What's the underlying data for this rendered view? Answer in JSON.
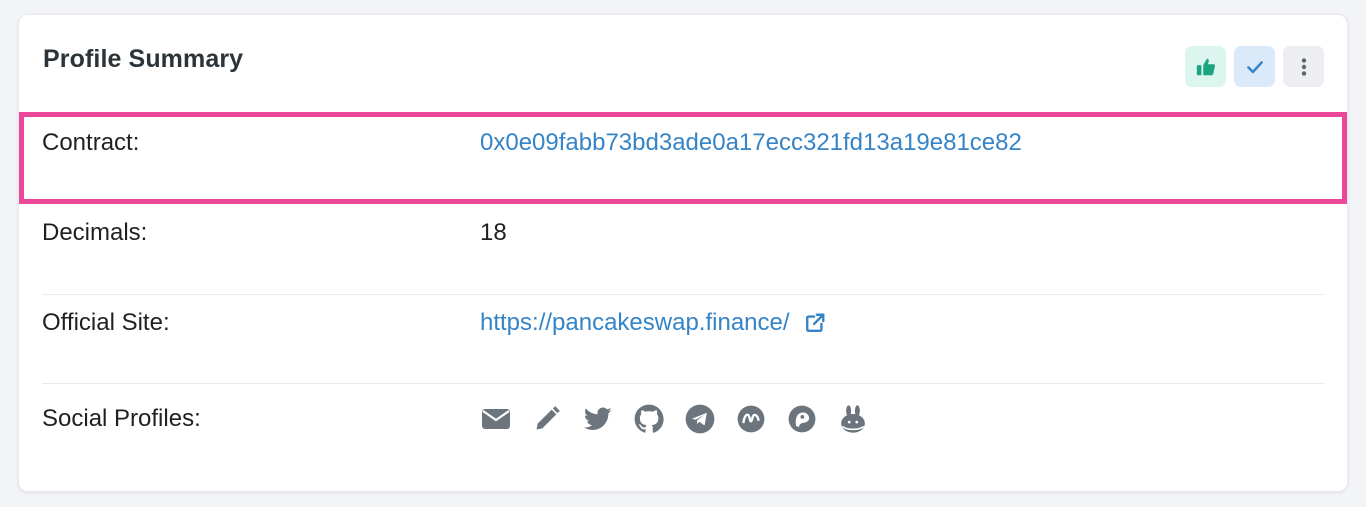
{
  "card": {
    "title": "Profile Summary",
    "actions": [
      {
        "name": "like",
        "icon": "thumbs-up-icon",
        "color": "#1aa47f"
      },
      {
        "name": "check",
        "icon": "check-icon",
        "color": "#3584c7"
      },
      {
        "name": "more",
        "icon": "vertical-ellipsis-icon",
        "color": "#6c757d"
      }
    ]
  },
  "rows": {
    "contract": {
      "label": "Contract:",
      "value": "0x0e09fabb73bd3ade0a17ecc321fd13a19e81ce82"
    },
    "decimals": {
      "label": "Decimals:",
      "value": "18"
    },
    "official_site": {
      "label": "Official Site:",
      "value": "https://pancakeswap.finance/",
      "icon": "external-link-icon"
    },
    "social_profiles": {
      "label": "Social Profiles:",
      "icons": [
        "email-icon",
        "pencil-icon",
        "twitter-icon",
        "github-icon",
        "telegram-icon",
        "coinmarketcap-icon",
        "coingecko-icon",
        "pancakeswap-bunny-icon"
      ]
    }
  },
  "colors": {
    "highlight_border": "#ec4899",
    "link": "#3584c7",
    "icon_gray": "#6c757d"
  }
}
